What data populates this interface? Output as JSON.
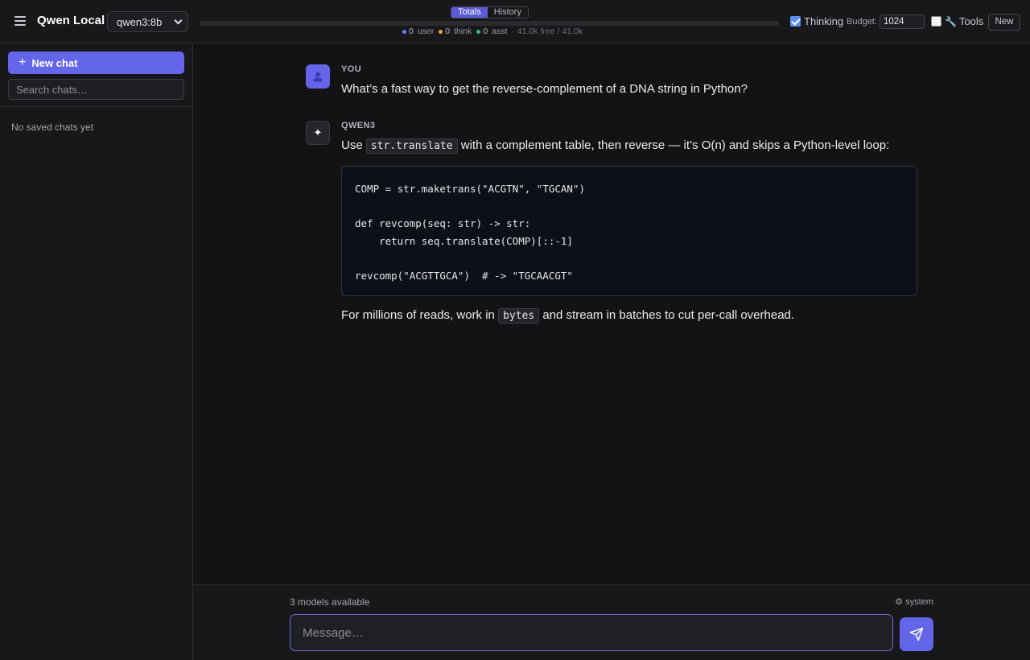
{
  "header": {
    "app_title": "Qwen Local",
    "model_selected": "qwen3:8b",
    "tabs": [
      {
        "label": "Totals",
        "active": true
      },
      {
        "label": "History",
        "active": false
      }
    ],
    "context": {
      "user_count": "0",
      "user_label": "user",
      "think_count": "0",
      "think_label": "think",
      "asst_count": "0",
      "asst_label": "asst",
      "free_text": "· 41.0k free / 41.0k",
      "user_color": "#6b7cff",
      "think_color": "#f0a030",
      "asst_color": "#2ec27e",
      "used_fraction": 0
    },
    "thinking_label": "Thinking",
    "thinking_checked": true,
    "budget_label": "Budget:",
    "budget_value": "1024",
    "tools_label": "Tools",
    "tools_checked": false,
    "new_label": "New"
  },
  "sidebar": {
    "new_chat_label": "New chat",
    "search_placeholder": "Search chats…",
    "empty_text": "No saved chats yet"
  },
  "messages": [
    {
      "role": "YOU",
      "icon": "user-icon",
      "text": "What’s a fast way to get the reverse-complement of a DNA string in Python?"
    },
    {
      "role": "QWEN3",
      "icon": "sparkle-icon",
      "intro_before": "Use ",
      "intro_code": "str.translate",
      "intro_after": " with a complement table, then reverse — it’s O(n) and skips a Python-level loop:",
      "code_lines": [
        "COMP = str.maketrans(\"ACGTN\", \"TGCAN\")",
        "",
        "def revcomp(seq: str) -> str:",
        "    return seq.translate(COMP)[::-1]",
        "",
        "revcomp(\"ACGTTGCA\")  # -> \"TGCAACGT\""
      ],
      "outro_before": "For millions of reads, work in ",
      "outro_code": "bytes",
      "outro_after": " and stream in batches to cut per-call overhead."
    }
  ],
  "composer": {
    "models_available": "3 models available",
    "system_label": "⚙ system",
    "placeholder": "Message…"
  },
  "colors": {
    "accent": "#6466ea",
    "background": "#131316",
    "panel": "#18181b"
  }
}
